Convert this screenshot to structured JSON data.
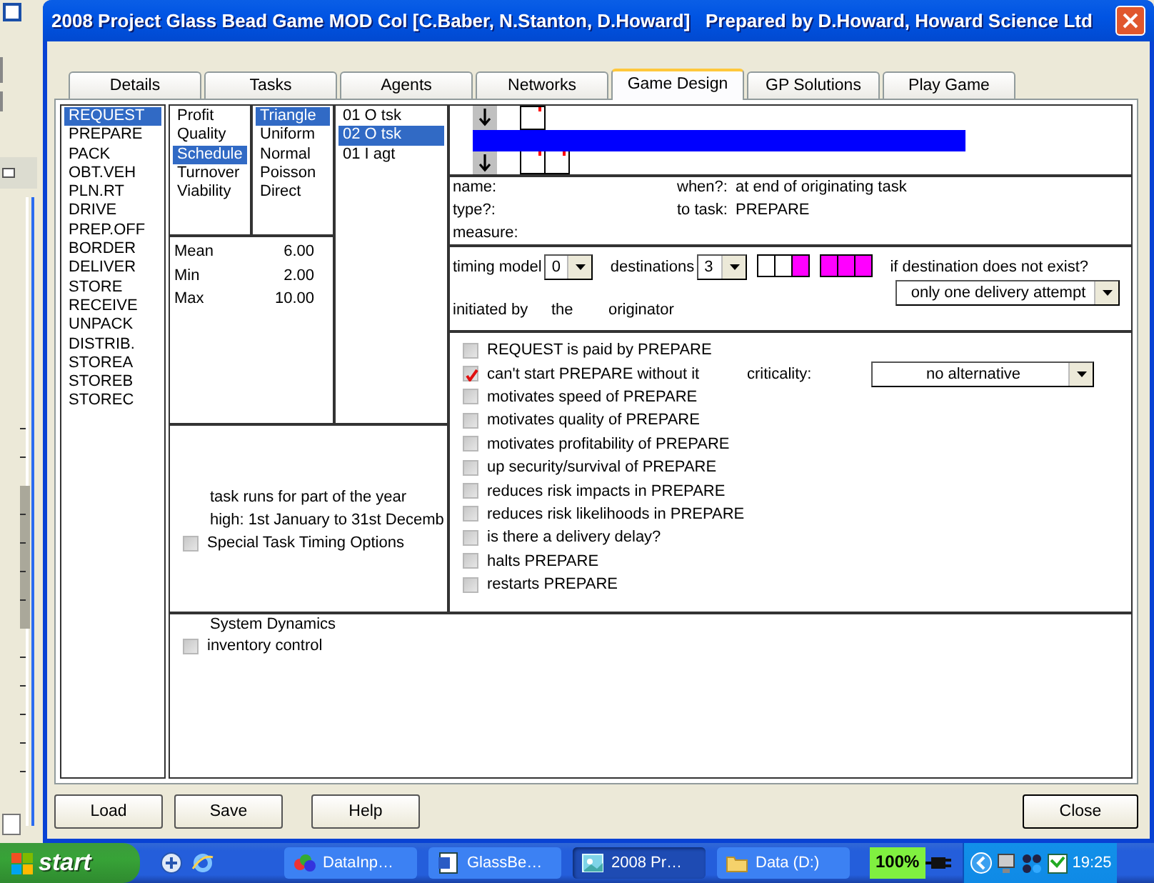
{
  "window": {
    "title": "2008 Project Glass Bead Game MOD Col [C.Baber, N.Stanton, D.Howard]   Prepared by D.Howard, Howard Science Ltd"
  },
  "tabs": [
    {
      "label": "Details",
      "selected": false
    },
    {
      "label": "Tasks",
      "selected": false
    },
    {
      "label": "Agents",
      "selected": false
    },
    {
      "label": "Networks",
      "selected": false
    },
    {
      "label": "Game Design",
      "selected": true
    },
    {
      "label": "GP Solutions",
      "selected": false
    },
    {
      "label": "Play Game",
      "selected": false
    }
  ],
  "tasks": [
    {
      "label": "REQUEST",
      "selected": true
    },
    {
      "label": "PREPARE",
      "selected": false
    },
    {
      "label": "PACK",
      "selected": false
    },
    {
      "label": "OBT.VEH",
      "selected": false
    },
    {
      "label": "PLN.RT",
      "selected": false
    },
    {
      "label": "DRIVE",
      "selected": false
    },
    {
      "label": "PREP.OFF",
      "selected": false
    },
    {
      "label": "BORDER",
      "selected": false
    },
    {
      "label": "DELIVER",
      "selected": false
    },
    {
      "label": "STORE",
      "selected": false
    },
    {
      "label": "RECEIVE",
      "selected": false
    },
    {
      "label": "UNPACK",
      "selected": false
    },
    {
      "label": "DISTRIB.",
      "selected": false
    },
    {
      "label": "STOREA",
      "selected": false
    },
    {
      "label": "STOREB",
      "selected": false
    },
    {
      "label": "STOREC",
      "selected": false
    }
  ],
  "criteria": [
    {
      "label": "Profit",
      "selected": false
    },
    {
      "label": "Quality",
      "selected": false
    },
    {
      "label": "Schedule",
      "selected": true
    },
    {
      "label": "Turnover",
      "selected": false
    },
    {
      "label": "Viability",
      "selected": false
    }
  ],
  "distributions": [
    {
      "label": "Triangle",
      "selected": true
    },
    {
      "label": "Uniform",
      "selected": false
    },
    {
      "label": "Normal",
      "selected": false
    },
    {
      "label": "Poisson",
      "selected": false
    },
    {
      "label": "Direct",
      "selected": false
    }
  ],
  "links": [
    {
      "label": "01 O tsk",
      "selected": false
    },
    {
      "label": "02 O tsk",
      "selected": true
    },
    {
      "label": "01 I agt",
      "selected": false
    }
  ],
  "stats": [
    {
      "label": "Mean",
      "value": "6.00"
    },
    {
      "label": "Min",
      "value": "2.00"
    },
    {
      "label": "Max",
      "value": "10.00"
    }
  ],
  "link_info": {
    "name_label": "name:",
    "type_label": "type?:",
    "measure_label": "measure:",
    "when_label": "when?:",
    "when_value": "at end of originating task",
    "to_task_label": "to task:",
    "to_task_value": "PREPARE"
  },
  "timing": {
    "timing_model_label": "timing model",
    "timing_model_value": "0",
    "destinations_label": "destinations",
    "destinations_value": "3",
    "slots_a": [
      {
        "filled": false
      },
      {
        "filled": false
      },
      {
        "filled": true
      }
    ],
    "slots_b": [
      {
        "filled": true
      },
      {
        "filled": true
      },
      {
        "filled": true
      }
    ],
    "missing_label": "if destination does not exist?",
    "missing_value": "only one delivery attempt",
    "initiated": [
      "initiated by",
      "the",
      "originator"
    ]
  },
  "effects": [
    {
      "label": "REQUEST is paid by PREPARE",
      "checked": false
    },
    {
      "label": "can't start PREPARE without it",
      "checked": true,
      "criticality": {
        "label": "criticality:",
        "value": "no alternative"
      }
    },
    {
      "label": "motivates speed of PREPARE",
      "checked": false
    },
    {
      "label": "motivates quality of PREPARE",
      "checked": false
    },
    {
      "label": "motivates profitability of PREPARE",
      "checked": false
    },
    {
      "label": "up security/survival of PREPARE",
      "checked": false
    },
    {
      "label": "reduces risk impacts in PREPARE",
      "checked": false
    },
    {
      "label": "reduces risk likelihoods in PREPARE",
      "checked": false
    },
    {
      "label": "is there a delivery delay?",
      "checked": false
    },
    {
      "label": "halts PREPARE",
      "checked": false
    },
    {
      "label": "restarts PREPARE",
      "checked": false
    }
  ],
  "task_timing": {
    "lines": [
      "task runs for part of the year",
      "high: 1st January to 31st Decemb"
    ],
    "option": {
      "label": "Special Task Timing Options",
      "checked": false
    }
  },
  "system_dynamics": {
    "title": "System Dynamics",
    "option": {
      "label": "inventory control",
      "checked": false
    }
  },
  "buttons": [
    "Load",
    "Save",
    "Help"
  ],
  "close_button": "Close",
  "taskbar": {
    "start": "start",
    "tasks": [
      {
        "label": "DataInp…",
        "kind": "app",
        "selected": false
      },
      {
        "label": "GlassBe…",
        "kind": "document",
        "selected": false
      },
      {
        "label": "2008 Pr…",
        "kind": "image",
        "selected": true
      },
      {
        "label": "Data (D:)",
        "kind": "folder",
        "selected": false
      }
    ],
    "battery": "100%",
    "clock": "19:25"
  }
}
